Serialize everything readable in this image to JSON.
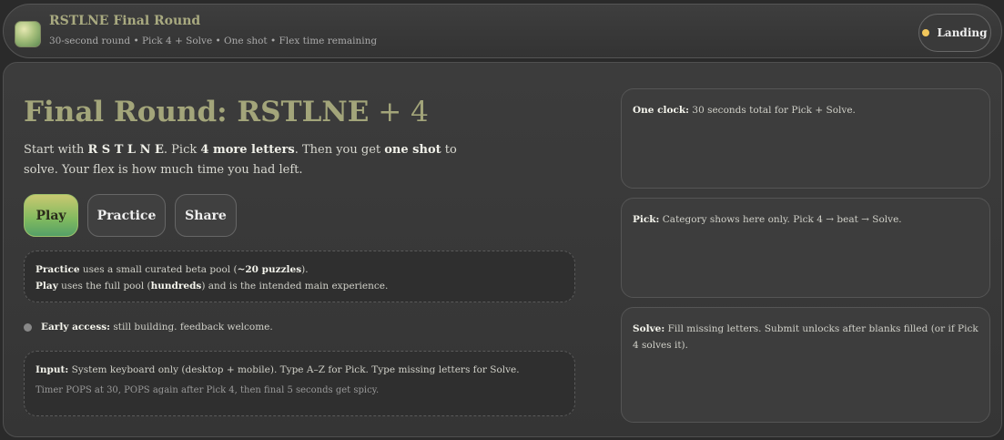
{
  "header": {
    "title": "RSTLNE Final Round",
    "subtitle": "30-second round • Pick 4 + Solve • One shot • Flex time remaining",
    "landing_label": "Landing",
    "status_color": "#f2c75c"
  },
  "hero": {
    "title_main": "Final Round: RSTLNE",
    "title_suffix": " + 4",
    "intro": {
      "t1": "Start with ",
      "letters": "R S T L N E",
      "t2": ". Pick ",
      "more": "4 more letters",
      "t3": ". Then you get ",
      "shot": "one shot",
      "t4": " to solve. Your flex is how much time you had left."
    }
  },
  "buttons": {
    "play": "Play",
    "practice": "Practice",
    "share": "Share"
  },
  "pool_note": {
    "practice_label": "Practice",
    "practice_t1": " uses a small curated beta pool (",
    "practice_count": "~20 puzzles",
    "practice_t2": ").",
    "play_label": "Play",
    "play_t1": " uses the full pool (",
    "play_count": "hundreds",
    "play_t2": ") and is the intended main experience."
  },
  "early_access": {
    "label": "Early access:",
    "text": " still building. feedback welcome."
  },
  "input_note": {
    "label": "Input:",
    "text": " System keyboard only (desktop + mobile). Type A–Z for Pick. Type missing letters for Solve.",
    "timer": "Timer POPS at 30, POPS again after Pick 4, then final 5 seconds get spicy."
  },
  "cards": {
    "clock_label": "One clock:",
    "clock_text": " 30 seconds total for Pick + Solve.",
    "pick_label": "Pick:",
    "pick_text": " Category shows here only. Pick 4 → beat → Solve.",
    "solve_label": "Solve:",
    "solve_text": " Fill missing letters. Submit unlocks after blanks filled (or if Pick 4 solves it)."
  },
  "colors": {
    "accent": "#a3a57a",
    "play_gradient_top": "#c9c971",
    "play_gradient_bottom": "#55a067",
    "background": "#2a2a2a"
  }
}
